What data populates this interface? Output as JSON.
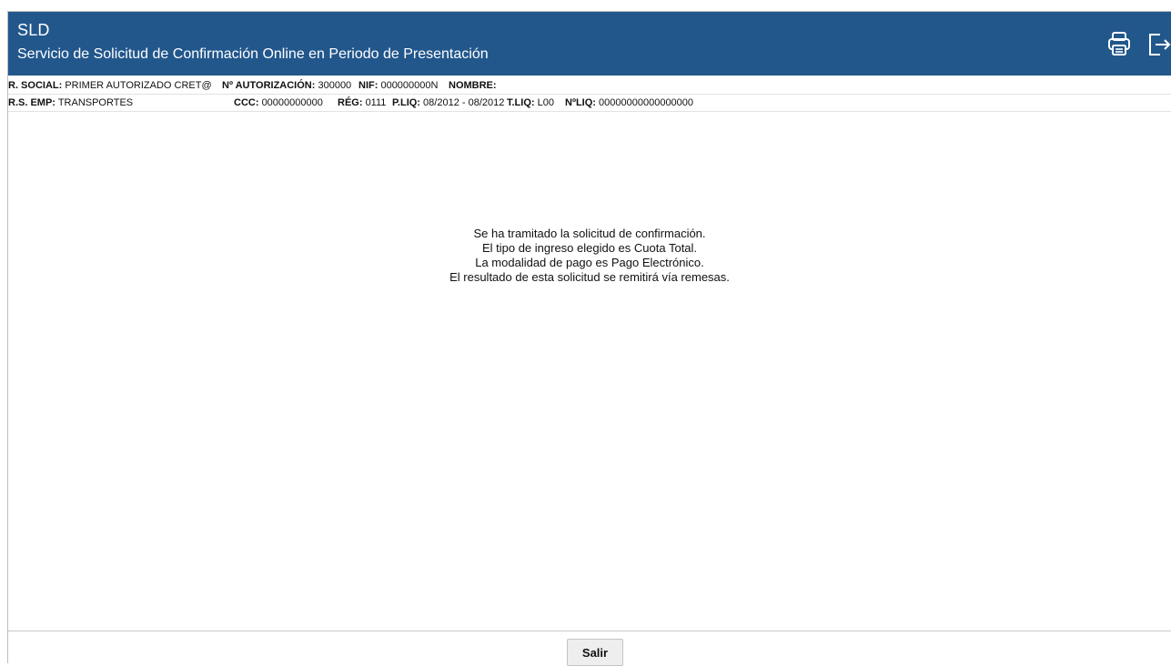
{
  "header": {
    "app_name": "SLD",
    "subtitle": "Servicio de Solicitud de Confirmación Online en Periodo de Presentación",
    "icons": [
      "printer-icon",
      "logout-icon"
    ],
    "background_color": "#22578c"
  },
  "info": {
    "row1": [
      {
        "label": "R. SOCIAL:",
        "value": "PRIMER AUTORIZADO CRET@"
      },
      {
        "label": "Nº AUTORIZACIÓN:",
        "value": "300000"
      },
      {
        "label": "NIF:",
        "value": "000000000N"
      },
      {
        "label": "NOMBRE:",
        "value": ""
      }
    ],
    "row2": [
      {
        "label": "R.S. EMP:",
        "value": "TRANSPORTES"
      },
      {
        "label": "CCC:",
        "value": "00000000000"
      },
      {
        "label": "RÉG:",
        "value": "0111"
      },
      {
        "label": "P.LIQ:",
        "value": "08/2012 - 08/2012"
      },
      {
        "label": "T.LIQ:",
        "value": "L00"
      },
      {
        "label": "NºLIQ:",
        "value": "00000000000000000"
      }
    ]
  },
  "message": {
    "lines": [
      "Se ha tramitado la solicitud de confirmación.",
      "El tipo de ingreso elegido es Cuota Total.",
      "La modalidad de pago es Pago Electrónico.",
      "El resultado de esta solicitud se remitirá vía remesas."
    ]
  },
  "footer": {
    "exit_label": "Salir"
  }
}
